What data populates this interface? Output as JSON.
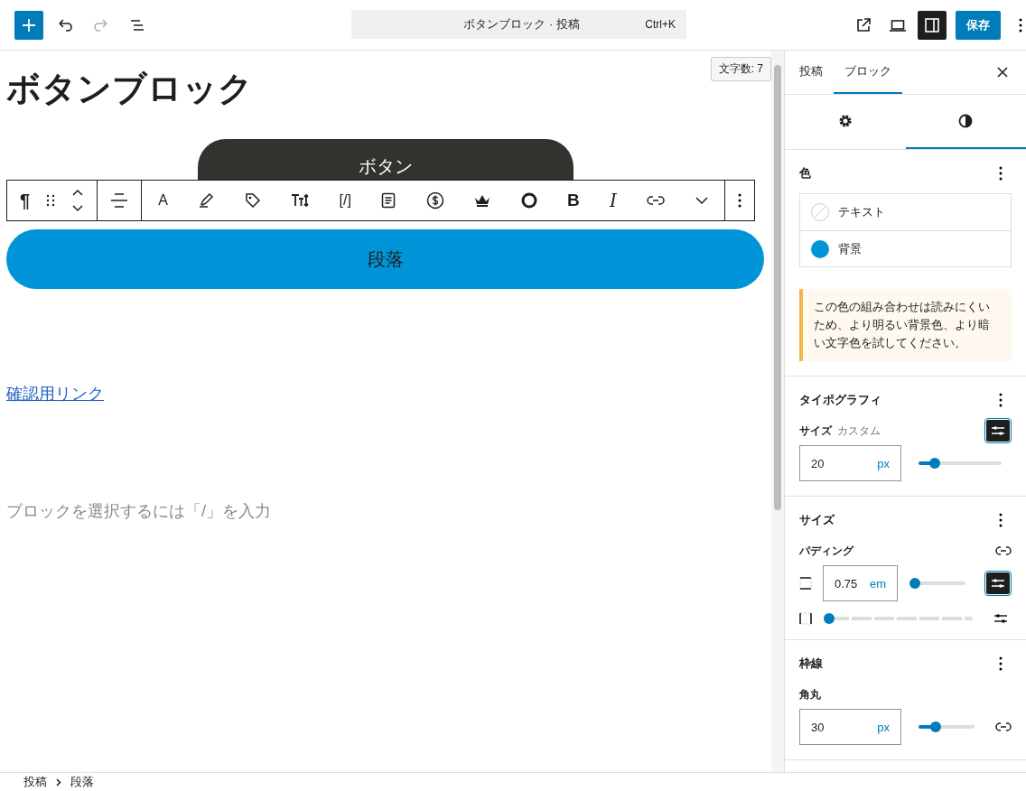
{
  "top_bar": {
    "command_title": "ボタンブロック · 投稿",
    "shortcut": "Ctrl+K",
    "redo_disabled": true,
    "sidebar_open": true,
    "save": "保存"
  },
  "editor": {
    "word_count": "文字数: 7",
    "title": "ボタンブロック",
    "buttons": [
      {
        "label": "ボタン",
        "color": "#32332f"
      },
      {
        "label": "段落",
        "color": "#0095d9"
      }
    ],
    "toolbar": {
      "paragraph": "¶",
      "font": "A",
      "code": "[/]",
      "bold": "B",
      "italic": "I"
    },
    "link": "確認用リンク",
    "placeholder": "ブロックを選択するには「/」を入力"
  },
  "sidebar": {
    "tabs": [
      {
        "label": "投稿",
        "selected": false
      },
      {
        "label": "ブロック",
        "selected": true
      }
    ],
    "subtabs": [
      {
        "kind": "settings",
        "selected": false
      },
      {
        "kind": "styles",
        "selected": true
      }
    ],
    "color": {
      "title": "色",
      "items": [
        {
          "label": "テキスト",
          "kind": "none"
        },
        {
          "label": "背景",
          "kind": "swatch",
          "color": "#0095d9"
        }
      ],
      "notice": "この色の組み合わせは読みにくいため、より明るい背景色、より暗い文字色を試してください。"
    },
    "typography": {
      "title": "タイポグラフィ",
      "size_label": "サイズ",
      "size_hint": "カスタム",
      "custom": true,
      "value": "20",
      "unit": "px",
      "level": 0.2
    },
    "dimensions": {
      "title": "サイズ",
      "padding_label": "パディング",
      "value": "0.75",
      "unit": "em",
      "level": 0,
      "custom": true,
      "spacing": {
        "level": 0
      }
    },
    "border": {
      "title": "枠線",
      "radius_label": "角丸",
      "value": "30",
      "unit": "px",
      "level": 0.3
    }
  },
  "breadcrumb": [
    "投稿",
    "段落"
  ]
}
